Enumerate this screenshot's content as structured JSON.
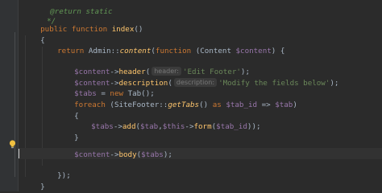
{
  "editor": {
    "line0_comment_top": "@return static",
    "line1_comment_end": "*/",
    "line2": {
      "kw1": "public",
      "kw2": "function",
      "name": "index",
      "parens": "()"
    },
    "line3_brace": "{",
    "line4": {
      "kw_return": "return",
      "cls": "Admin",
      "sep": "::",
      "method": "content",
      "open": "(",
      "kw_function": "function",
      "param_open": " (Content ",
      "var": "$content",
      "param_close": ") {"
    },
    "line6": {
      "var": "$content",
      "arrow": "->",
      "method": "header",
      "open": "(",
      "hint": "header:",
      "str": "'Edit Footer'",
      "close": ");"
    },
    "line7": {
      "var": "$content",
      "arrow": "->",
      "method": "description",
      "open": "(",
      "hint": "description:",
      "str": "'Modify the fields below'",
      "close": ");"
    },
    "line8": {
      "var": "$tabs",
      "eq": " = ",
      "kw_new": "new",
      "cls": " Tab();"
    },
    "line9": {
      "kw": "foreach",
      "cls": " (SiteFooter",
      "sep": "::",
      "method": "getTabs",
      "mid": "() ",
      "kw_as": "as",
      "var1": "$tab_id",
      "arrow": " => ",
      "var2": "$tab",
      "close": ")"
    },
    "line10_brace": "{",
    "line11": {
      "var1": "$tabs",
      "arrow1": "->",
      "method1": "add",
      "open": "(",
      "var2": "$tab",
      "comma": ",",
      "var3": "$this",
      "arrow2": "->",
      "method2": "form",
      "open2": "(",
      "var4": "$tab_id",
      "close": "));"
    },
    "line12_brace": "}",
    "line14": {
      "var": "$content",
      "arrow": "->",
      "method": "body",
      "open": "(",
      "arg": "$tabs",
      "close": ");"
    },
    "line16_close": "});",
    "line17_brace": "}"
  },
  "colors": {
    "background": "#2b2b2b",
    "keyword": "#cc7832",
    "function_name": "#ffc66d",
    "variable": "#9876aa",
    "string": "#6a8759",
    "default_text": "#a9b7c6",
    "intention_bulb": "#f0c040"
  },
  "icons": {
    "gutter_action": "intention-bulb-icon"
  }
}
